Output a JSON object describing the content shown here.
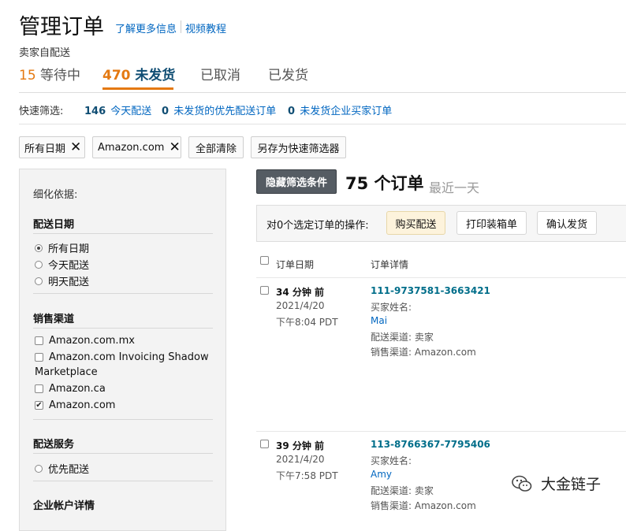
{
  "header": {
    "title": "管理订单",
    "help_links": [
      "了解更多信息",
      "视频教程"
    ],
    "subtitle": "卖家自配送"
  },
  "tabs": [
    {
      "count": "15",
      "label": "等待中",
      "active": false
    },
    {
      "count": "470",
      "label": "未发货",
      "active": true
    },
    {
      "count": "",
      "label": "已取消",
      "active": false
    },
    {
      "count": "",
      "label": "已发货",
      "active": false
    }
  ],
  "quick_filters": {
    "label": "快速筛选:",
    "items": [
      {
        "count": "146",
        "label": "今天配送"
      },
      {
        "count": "0",
        "label": "未发货的优先配送订单"
      },
      {
        "count": "0",
        "label": "未发货企业买家订单"
      }
    ]
  },
  "chips": {
    "all_dates": "所有日期",
    "marketplace": "Amazon.com",
    "close_glyph": "✕",
    "clear_all": "全部清除",
    "save_as": "另存为快速筛选器"
  },
  "refine": {
    "label": "细化依据:",
    "sections": {
      "ship_date": {
        "title": "配送日期",
        "options": [
          "所有日期",
          "今天配送",
          "明天配送"
        ],
        "selected_index": 0
      },
      "sales_channel": {
        "title": "销售渠道",
        "options": [
          "Amazon.com.mx",
          "Amazon.com Invoicing Shadow",
          "Marketplace",
          "Amazon.ca",
          "Amazon.com"
        ],
        "checked": [
          false,
          false,
          null,
          false,
          true
        ]
      },
      "ship_service": {
        "title": "配送服务",
        "options": [
          "优先配送"
        ]
      },
      "business_account": {
        "title": "企业帐户详情"
      }
    }
  },
  "results": {
    "hide_filters_button": "隐藏筛选条件",
    "order_count": "75 个订单",
    "period": "最近一天",
    "bulk_label": "对0个选定订单的操作:",
    "actions": [
      "购买配送",
      "打印装箱单",
      "确认发货"
    ],
    "columns": [
      "订单日期",
      "订单详情"
    ],
    "checkmark_glyph": "✔"
  },
  "orders": [
    {
      "ago": "34 分钟 前",
      "date": "2021/4/20",
      "time": "下午8:04 PDT",
      "order_id": "111-9737581-3663421",
      "buyer_label": "买家姓名:",
      "buyer": "Mai",
      "fulfillment": "配送渠道: 卖家",
      "channel": "销售渠道: Amazon.com"
    },
    {
      "ago": "39 分钟 前",
      "date": "2021/4/20",
      "time": "下午7:58 PDT",
      "order_id": "113-8766367-7795406",
      "buyer_label": "买家姓名:",
      "buyer": "Amy",
      "fulfillment": "配送渠道: 卖家",
      "channel": "销售渠道: Amazon.com"
    }
  ],
  "watermark": {
    "text": "大金链子",
    "icon": "wechat-icon"
  }
}
